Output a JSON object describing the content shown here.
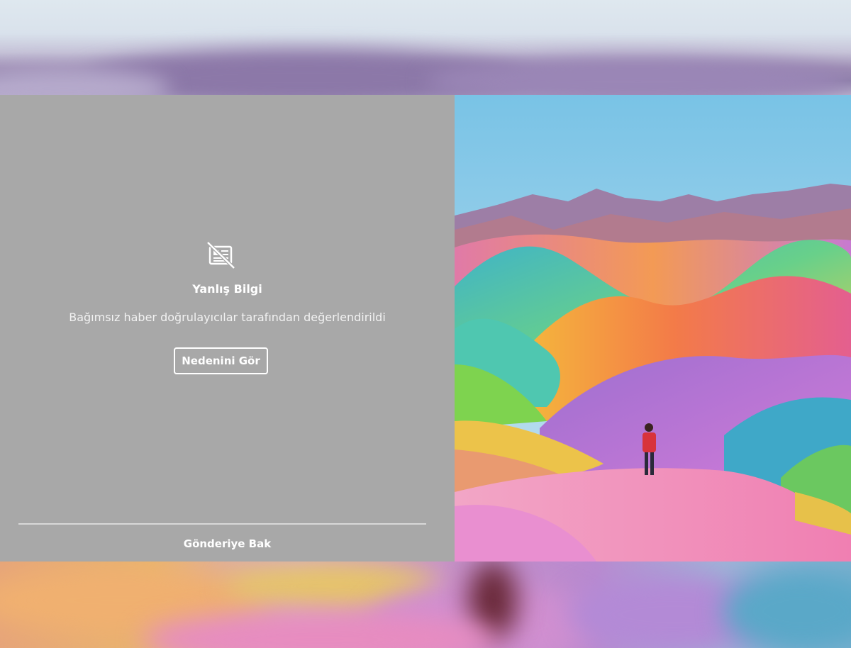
{
  "warning": {
    "title": "Yanlış Bilgi",
    "subtitle": "Bağımsız haber doğrulayıcılar tarafından değerlendirildi",
    "reason_button": "Nedenini Gör",
    "view_post": "Gönderiye Bak",
    "icon": "news-hidden-icon"
  },
  "colors": {
    "panel": "#a8a8a8",
    "text": "#ffffff"
  }
}
